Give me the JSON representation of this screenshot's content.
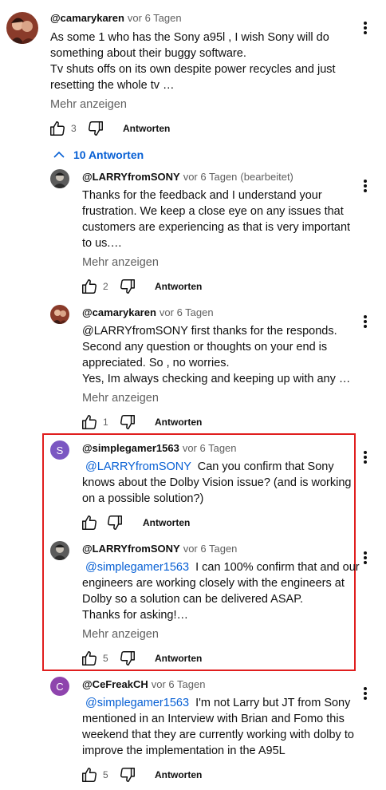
{
  "top_comment": {
    "handle": "@camarykaren",
    "time": "vor 6 Tagen",
    "lines": [
      "As some 1 who has the Sony a95l , I wish Sony will do",
      "something about their buggy software.",
      "Tv shuts offs on its own despite power recycles and just",
      "resetting the whole tv …"
    ],
    "more": "Mehr anzeigen",
    "likes": "3",
    "reply_label": "Antworten"
  },
  "replies_toggle": {
    "label": "10 Antworten"
  },
  "replies": [
    {
      "handle": "@LARRYfromSONY",
      "time": "vor 6 Tagen",
      "edited": "(bearbeitet)",
      "lines": [
        "Thanks for the feedback and I understand your",
        "frustration. We keep a close eye on any issues that",
        "customers are experiencing as that is very important",
        "to us.…"
      ],
      "more": "Mehr anzeigen",
      "likes": "2",
      "reply_label": "Antworten"
    },
    {
      "handle": "@camarykaren",
      "time": "vor 6 Tagen",
      "lines": [
        "@LARRYfromSONY   first thanks for the responds.",
        "Second any question or thoughts on your end is",
        "appreciated. So , no  worries.",
        "Yes, Im always checking  and keeping up with any  …"
      ],
      "more": "Mehr anzeigen",
      "likes": "1",
      "reply_label": "Antworten"
    },
    {
      "handle": "@simplegamer1563",
      "time": "vor 6 Tagen",
      "avatar_letter": "S",
      "mention": "@LARRYfromSONY",
      "line1_rest": "  Can you confirm that Sony",
      "lines": [
        "knows about the Dolby Vision issue? (and is working",
        "on a possible solution?)"
      ],
      "likes": "",
      "reply_label": "Antworten"
    },
    {
      "handle": "@LARRYfromSONY",
      "time": "vor 6 Tagen",
      "mention": "@simplegamer1563",
      "line1_rest": "  I can 100% confirm that and our",
      "lines": [
        "engineers are working closely with the engineers at",
        "Dolby so a solution can be delivered ASAP.",
        "Thanks for asking!…"
      ],
      "more": "Mehr anzeigen",
      "likes": "5",
      "reply_label": "Antworten"
    },
    {
      "handle": "@CeFreakCH",
      "time": "vor 6 Tagen",
      "avatar_letter": "C",
      "mention": "@simplegamer1563",
      "line1_rest": "  I'm not Larry but JT from Sony",
      "lines": [
        "mentioned in an Interview with Brian and Fomo this",
        "weekend that they are currently working with dolby to",
        "improve the implementation in the A95L"
      ],
      "likes": "5",
      "reply_label": "Antworten"
    }
  ],
  "colors": {
    "link": "#065fd4",
    "highlight": "#e01e1e",
    "avatar_s": "#7b57c2",
    "avatar_c": "#8e44ad"
  },
  "icons": [
    "thumb-up-icon",
    "thumb-down-icon",
    "more-vert-icon",
    "chevron-up-icon"
  ]
}
